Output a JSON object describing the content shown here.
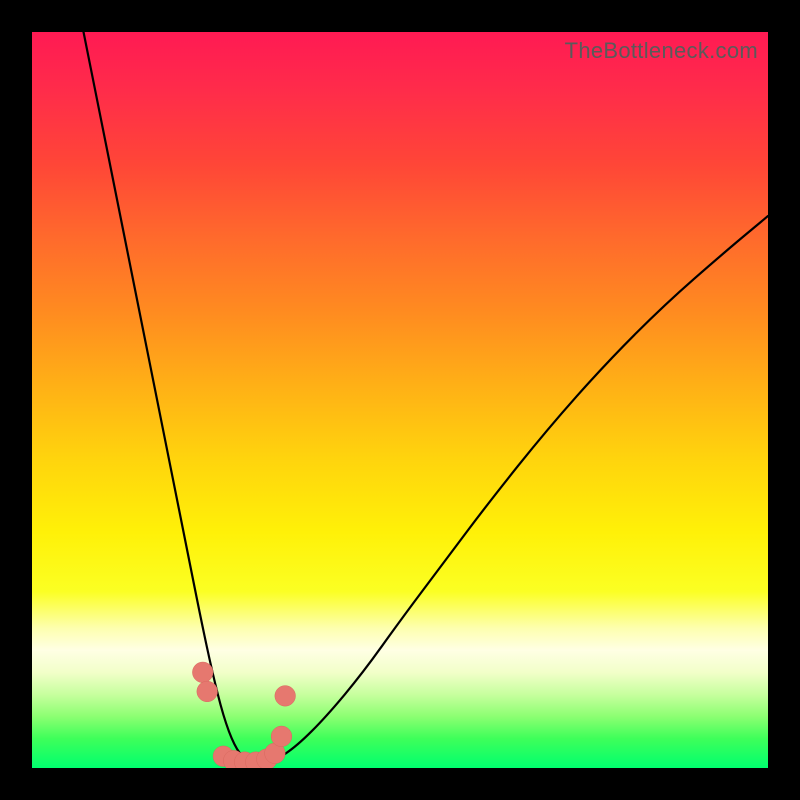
{
  "attribution": "TheBottleneck.com",
  "colors": {
    "page_bg": "#000000",
    "curve": "#000000",
    "marker_fill": "#e6786f",
    "marker_stroke": "#d8685f",
    "gradient_top": "#ff1a53",
    "gradient_mid": "#fff108",
    "gradient_bottom": "#00ff6e"
  },
  "chart_data": {
    "type": "line",
    "title": "",
    "xlabel": "",
    "ylabel": "",
    "xlim": [
      0,
      100
    ],
    "ylim": [
      0,
      100
    ],
    "grid": false,
    "legend": false,
    "note": "No axis tick labels are visible; x/y values are read off the plotting area in percent of width/height (0,0 = bottom-left). The curve depicts a V-shaped bottleneck profile with minimum near x≈30.",
    "series": [
      {
        "name": "curve-left",
        "x": [
          7,
          9,
          11,
          13,
          15,
          17,
          19,
          21,
          23,
          24.5,
          26,
          27.5,
          29,
          30.5
        ],
        "y": [
          100,
          90,
          80,
          70,
          60,
          50,
          40,
          30,
          20,
          13,
          7,
          3,
          1,
          0.5
        ]
      },
      {
        "name": "curve-right",
        "x": [
          30.5,
          33,
          36,
          40,
          45,
          50,
          56,
          62,
          70,
          78,
          86,
          94,
          100
        ],
        "y": [
          0.5,
          1,
          3,
          7,
          13,
          20,
          28,
          36,
          46,
          55,
          63,
          70,
          75
        ]
      }
    ],
    "markers": {
      "name": "highlighted-points",
      "note": "Salmon circular markers clustered near the curve minimum, radius ≈ 1.4% of plot width.",
      "x": [
        23.2,
        23.8,
        26.0,
        27.4,
        28.9,
        30.4,
        31.9,
        33.0,
        33.9,
        34.4
      ],
      "y": [
        13.0,
        10.4,
        1.6,
        1.0,
        0.8,
        0.8,
        1.2,
        2.0,
        4.3,
        9.8
      ]
    }
  }
}
